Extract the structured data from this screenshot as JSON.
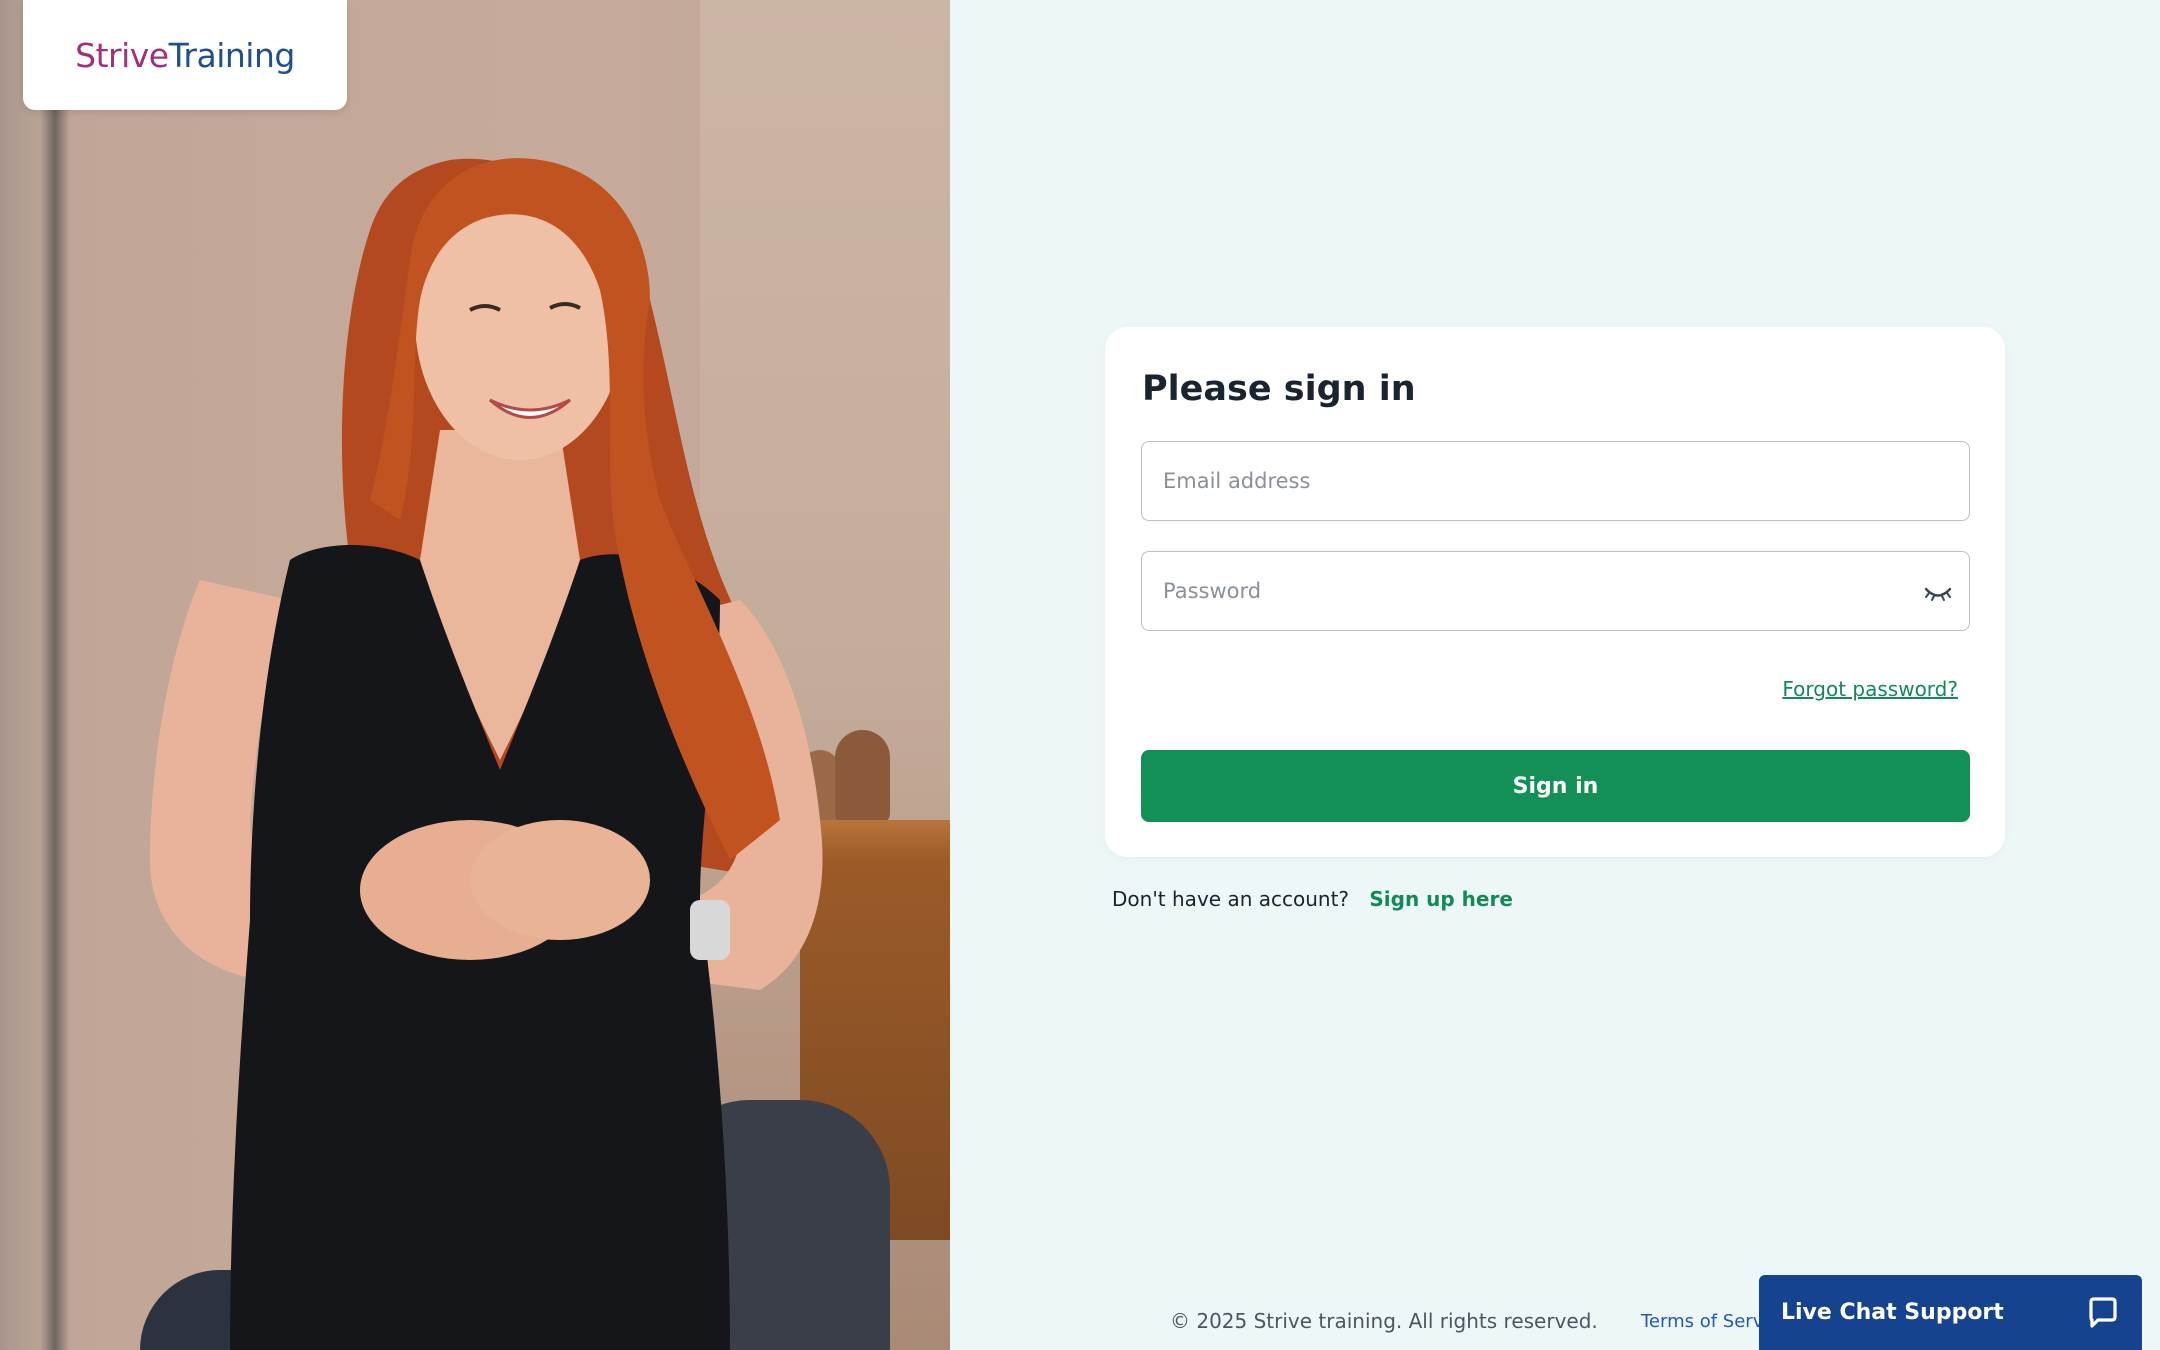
{
  "brand": {
    "logo_part1": "Strive",
    "logo_part2": "Training",
    "primary_color": "#138f58",
    "logo_purple": "#a0307c",
    "logo_blue": "#1f4f8f"
  },
  "signin": {
    "title": "Please sign in",
    "email_placeholder": "Email address",
    "password_placeholder": "Password",
    "forgot_password": "Forgot password?",
    "submit_label": "Sign in",
    "eye_icon": "eye-closed-icon"
  },
  "signup": {
    "prompt": "Don't have an account?",
    "link_label": "Sign up here"
  },
  "footer": {
    "copyright": "© 2025 Strive training. All rights reserved.",
    "terms": "Terms of Servi"
  },
  "chat": {
    "label": "Live Chat Support",
    "icon": "chat-bubble-icon",
    "color": "#15438f"
  },
  "hero_image": {
    "icon": "photo-woman-smiling"
  }
}
